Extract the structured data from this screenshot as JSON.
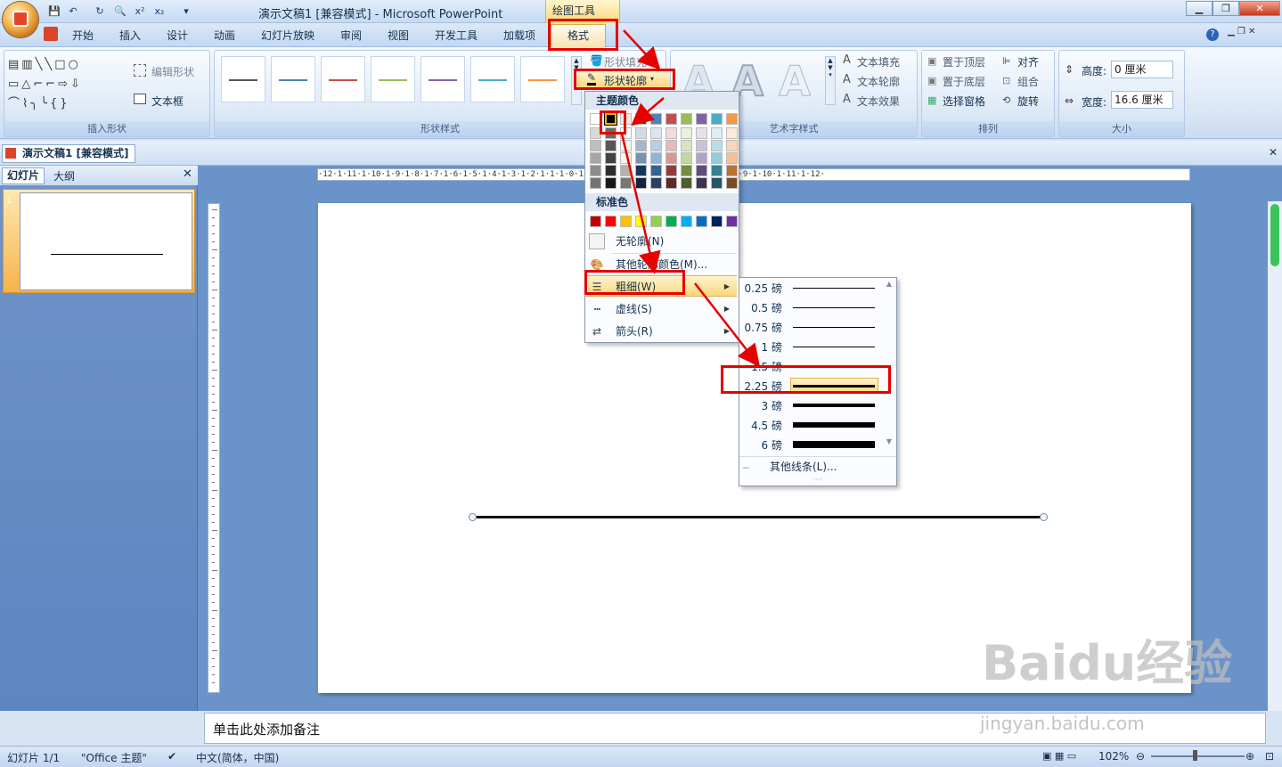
{
  "window": {
    "title": "演示文稿1 [兼容模式] - Microsoft PowerPoint",
    "context_group": "绘图工具",
    "qat": [
      "save-icon",
      "undo-icon",
      "redo-icon",
      "print-preview-icon",
      "superscript-icon",
      "subscript-icon"
    ],
    "qat_labels": {
      "sup": "x²",
      "sub": "x₂"
    }
  },
  "tabs": [
    "开始",
    "插入",
    "设计",
    "动画",
    "幻灯片放映",
    "审阅",
    "视图",
    "开发工具",
    "加载项",
    "格式"
  ],
  "ribbon": {
    "insert_shapes": {
      "label": "插入形状",
      "edit_shape": "编辑形状",
      "text_box": "文本框"
    },
    "shape_styles": {
      "label": "形状样式",
      "fill": "形状填充",
      "outline": "形状轮廓",
      "swatch_colors": [
        "#555555",
        "#4f81bd",
        "#c0504d",
        "#9bbb59",
        "#8064a2",
        "#4bacc6",
        "#f79646"
      ]
    },
    "wordart": {
      "label": "艺术字样式",
      "text_fill": "文本填充",
      "text_outline": "文本轮廓",
      "text_effect": "文本效果"
    },
    "arrange": {
      "label": "排列",
      "bring_front": "置于顶层",
      "send_back": "置于底层",
      "selection_pane": "选择窗格",
      "align": "对齐",
      "group": "组合",
      "rotate": "旋转"
    },
    "size": {
      "label": "大小",
      "height_label": "高度:",
      "height_value": "0 厘米",
      "width_label": "宽度:",
      "width_value": "16.6 厘米"
    }
  },
  "document": {
    "doc_tab": "演示文稿1 [兼容模式]",
    "pane_tabs": [
      "幻灯片",
      "大纲"
    ],
    "slide_number": "1",
    "notes_placeholder": "单击此处添加备注",
    "ruler_h": "·12·1·11·1·10·1·9·1·8·1·7·1·6·1·5·1·4·1·3·1·2·1·1·1·0·1·1·1·2·1·3·1·4·1·5·1·6·1·7·1·8·1·9·1·10·1·11·1·12·"
  },
  "outline_menu": {
    "theme_colors_label": "主题颜色",
    "theme_row": [
      "#ffffff",
      "#000000",
      "#eeece1",
      "#1f497d",
      "#4f81bd",
      "#c0504d",
      "#9bbb59",
      "#8064a2",
      "#4bacc6",
      "#f79646"
    ],
    "standard_label": "标准色",
    "standard_row": [
      "#c00000",
      "#ff0000",
      "#ffc000",
      "#ffff00",
      "#92d050",
      "#00b050",
      "#00b0f0",
      "#0070c0",
      "#002060",
      "#7030a0"
    ],
    "no_outline": "无轮廓(N)",
    "more_colors": "其他轮廓颜色(M)...",
    "weight": "粗细(W)",
    "dashes": "虚线(S)",
    "arrows": "箭头(R)"
  },
  "weight_menu": {
    "items": [
      {
        "label": "0.25 磅",
        "weight_pt": 0.25
      },
      {
        "label": "0.5 磅",
        "weight_pt": 0.5
      },
      {
        "label": "0.75 磅",
        "weight_pt": 0.75
      },
      {
        "label": "1 磅",
        "weight_pt": 1
      },
      {
        "label": "1.5 磅",
        "weight_pt": 1.5
      },
      {
        "label": "2.25 磅",
        "weight_pt": 2.25,
        "selected": true
      },
      {
        "label": "3 磅",
        "weight_pt": 3
      },
      {
        "label": "4.5 磅",
        "weight_pt": 4.5
      },
      {
        "label": "6 磅",
        "weight_pt": 6
      }
    ],
    "more_lines": "其他线条(L)..."
  },
  "status": {
    "slide": "幻灯片 1/1",
    "theme": "\"Office 主题\"",
    "language": "中文(简体，中国)",
    "zoom": "102%"
  },
  "watermark": {
    "main": "Baidu经验",
    "sub": "jingyan.baidu.com"
  },
  "colors": {
    "highlight": "#e60000",
    "selected_item": "#fbd878"
  }
}
